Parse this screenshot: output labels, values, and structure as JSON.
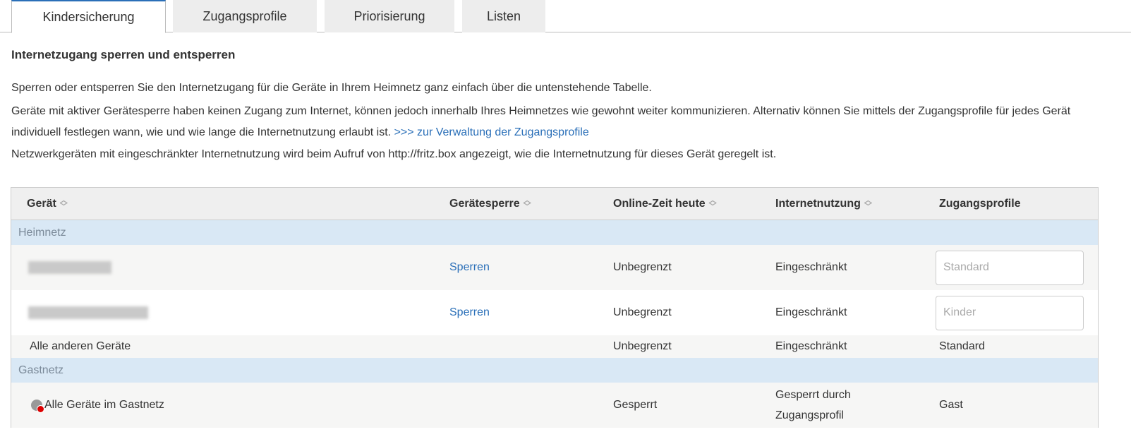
{
  "tabs": [
    "Kindersicherung",
    "Zugangsprofile",
    "Priorisierung",
    "Listen"
  ],
  "heading": "Internetzugang sperren und entsperren",
  "para1": "Sperren oder entsperren Sie den Internetzugang für die Geräte in Ihrem Heimnetz ganz einfach über die untenstehende Tabelle.",
  "para2": "Geräte mit aktiver Gerätesperre haben keinen Zugang zum Internet, können jedoch innerhalb Ihres Heimnetzes wie gewohnt weiter kommunizieren. Alternativ können Sie mittels der Zugangsprofile für jedes Gerät individuell festlegen wann, wie und wie lange die Internetnutzung erlaubt ist. ",
  "para2_link": ">>> zur Verwaltung der Zugangsprofile",
  "para3": "Netzwerkgeräten mit eingeschränkter Internetnutzung wird beim Aufruf von http://fritz.box angezeigt, wie die Internetnutzung für dieses Gerät geregelt ist.",
  "table": {
    "headers": [
      "Gerät",
      "Gerätesperre",
      "Online-Zeit heute",
      "Internetnutzung",
      "Zugangsprofile"
    ],
    "groups": [
      "Heimnetz",
      "Gastnetz"
    ],
    "rows": [
      {
        "lock": "Sperren",
        "online": "Unbegrenzt",
        "usage": "Eingeschränkt",
        "profile": "Standard"
      },
      {
        "lock": "Sperren",
        "online": "Unbegrenzt",
        "usage": "Eingeschränkt",
        "profile": "Kinder"
      },
      {
        "device": "Alle anderen Geräte",
        "online": "Unbegrenzt",
        "usage": "Eingeschränkt",
        "profile": "Standard"
      },
      {
        "device": "Alle Geräte im Gastnetz",
        "online": "Gesperrt",
        "usage": "Gesperrt durch Zugangsprofil",
        "profile": "Gast"
      }
    ]
  }
}
